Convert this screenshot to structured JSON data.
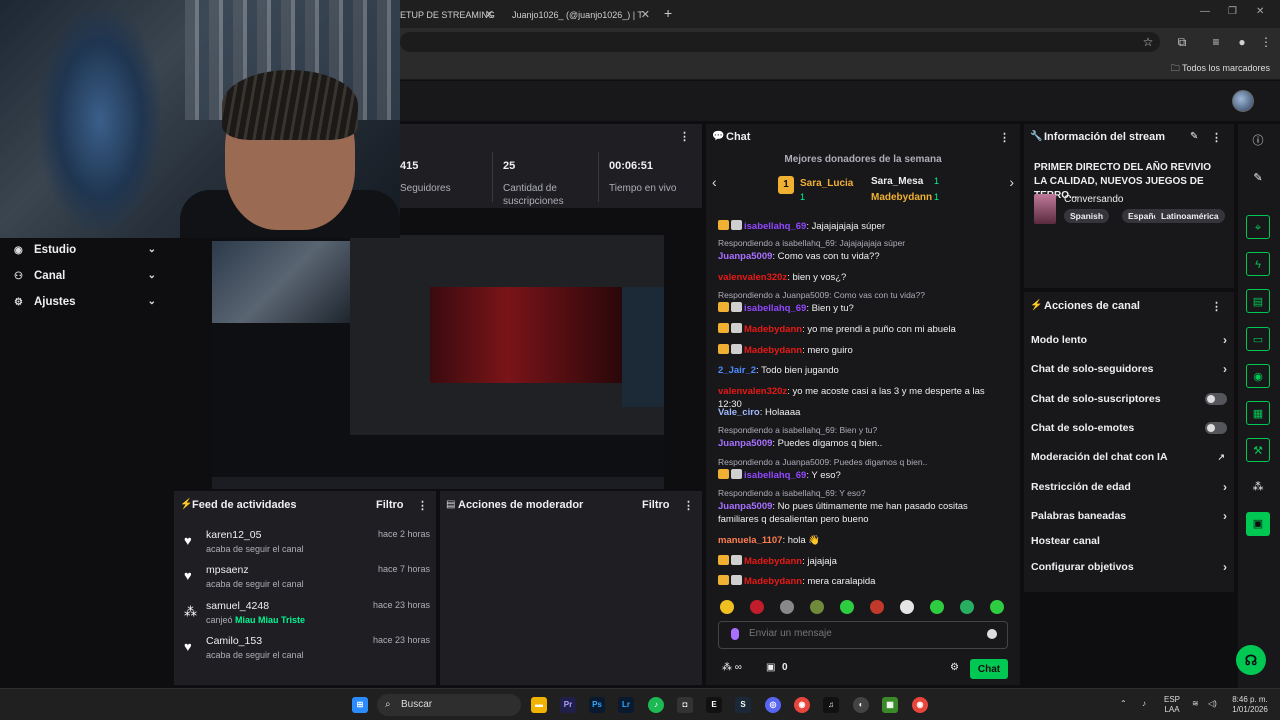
{
  "browser": {
    "tabs": [
      {
        "label": "ETUP DE STREAMING"
      },
      {
        "label": "Juanjo1026_ (@juanjo1026_) | T"
      }
    ],
    "new_tab": "+",
    "bookmarks_label": "Todos los marcadores"
  },
  "leftnav": {
    "items": [
      {
        "label": "Estudio"
      },
      {
        "label": "Canal"
      },
      {
        "label": "Ajustes"
      }
    ]
  },
  "stats": {
    "items": [
      {
        "value": "415",
        "label": "Seguidores"
      },
      {
        "value": "25",
        "label": "Cantidad de suscripciones"
      },
      {
        "value": "00:06:51",
        "label": "Tiempo en vivo"
      }
    ]
  },
  "feed": {
    "title": "Feed de actividades",
    "filter": "Filtro",
    "items": [
      {
        "user": "karen12_05",
        "time": "hace 2 horas",
        "action": "acaba de seguir el canal",
        "icon": "heart-icon"
      },
      {
        "user": "mpsaenz",
        "time": "hace 7 horas",
        "action": "acaba de seguir el canal",
        "icon": "heart-icon"
      },
      {
        "user": "samuel_4248",
        "time": "hace 23 horas",
        "action_prefix": "canjeó",
        "action_highlight": "Miau Miau Triste",
        "icon": "points-icon"
      },
      {
        "user": "Camilo_153",
        "time": "hace 23 horas",
        "action": "acaba de seguir el canal",
        "icon": "heart-icon"
      }
    ]
  },
  "mod": {
    "title": "Acciones de moderador",
    "filter": "Filtro"
  },
  "chat": {
    "title": "Chat",
    "donors_title": "Mejores donadores de la semana",
    "donors": [
      {
        "name": "Sara_Lucia",
        "count": "1"
      },
      {
        "name": "Sara_Mesa",
        "count": "1"
      },
      {
        "name": "Madebydann",
        "count": "1"
      }
    ],
    "messages": [
      {
        "user": "isabellahq_69",
        "text": ": Jajajajajaja súper",
        "color": "#9147ff",
        "badges": true
      },
      {
        "reply": "Respondiendo a isabellahq_69: Jajajajajaja súper",
        "user": "Juanpa5009",
        "text": ": Como vas con tu vida??",
        "color": "#a970ff"
      },
      {
        "user": "valenvalen320z",
        "text": ": bien y vos¿?",
        "color": "#e91916"
      },
      {
        "reply": "Respondiendo a Juanpa5009: Como vas con tu vida??",
        "user": "isabellahq_69",
        "text": ": Bien y tu?",
        "color": "#9147ff",
        "badges": true
      },
      {
        "user": "Madebydann",
        "text": ": yo me prendi a puño con mi abuela",
        "color": "#e91916",
        "badges": true
      },
      {
        "user": "Madebydann",
        "text": ": mero guiro",
        "color": "#e91916",
        "badges": true
      },
      {
        "user": "2_Jair_2",
        "text": ": Todo bien jugando",
        "color": "#4f8cff"
      },
      {
        "user": "valenvalen320z",
        "text": ": yo me acoste casi a las 3 y me desperte a las 12:30",
        "color": "#e91916"
      },
      {
        "user": "Vale_ciro",
        "text": ": Holaaaa",
        "color": "#9fb9ff"
      },
      {
        "reply": "Respondiendo a isabellahq_69: Bien y tu?",
        "user": "Juanpa5009",
        "text": ": Puedes digamos q bien..",
        "color": "#a970ff"
      },
      {
        "reply": "Respondiendo a Juanpa5009: Puedes digamos q bien..",
        "user": "isabellahq_69",
        "text": ": Y eso?",
        "color": "#9147ff",
        "badges": true
      },
      {
        "reply": "Respondiendo a isabellahq_69: Y eso?",
        "user": "Juanpa5009",
        "text": ": No pues últimamente me han pasado cositas familiares q desalientan pero bueno",
        "color": "#a970ff"
      },
      {
        "user": "manuela_1107",
        "text": ": hola 👋",
        "color": "#ff7f50"
      },
      {
        "user": "Madebydann",
        "text": ": jajajaja",
        "color": "#e91916",
        "badges": true
      },
      {
        "user": "Madebydann",
        "text": ": mera caralapida",
        "color": "#e91916",
        "badges": true
      }
    ],
    "input_placeholder": "Enviar un mensaje",
    "points": "0",
    "send_label": "Chat"
  },
  "stream_info": {
    "title": "Información del stream",
    "stream_title": "PRIMER DIRECTO DEL AÑO REVIVIO LA CALIDAD, NUEVOS JUEGOS DE TERRO...",
    "category": "Conversando",
    "tags": [
      "Spanish",
      "Español",
      "Latinoamérica"
    ]
  },
  "channel_actions": {
    "title": "Acciones de canal",
    "items": [
      {
        "label": "Modo lento",
        "control": "chevron"
      },
      {
        "label": "Chat de solo-seguidores",
        "control": "chevron"
      },
      {
        "label": "Chat de solo-suscriptores",
        "control": "toggle"
      },
      {
        "label": "Chat de solo-emotes",
        "control": "toggle"
      },
      {
        "label": "Moderación del chat con IA",
        "control": "external"
      },
      {
        "label": "Restricción de edad",
        "control": "chevron"
      },
      {
        "label": "Palabras baneadas",
        "control": "chevron"
      },
      {
        "label": "Hostear canal",
        "control": "none"
      },
      {
        "label": "Configurar objetivos",
        "control": "chevron"
      }
    ]
  },
  "taskbar": {
    "search_placeholder": "Buscar",
    "lang_top": "ESP",
    "lang_bottom": "LAA",
    "time": "8:46 p. m.",
    "date": "1/01/2026"
  },
  "colors": {
    "accent": "#00c853",
    "purple": "#9147ff",
    "panel": "#1f1f23",
    "bg": "#0e0e10"
  }
}
